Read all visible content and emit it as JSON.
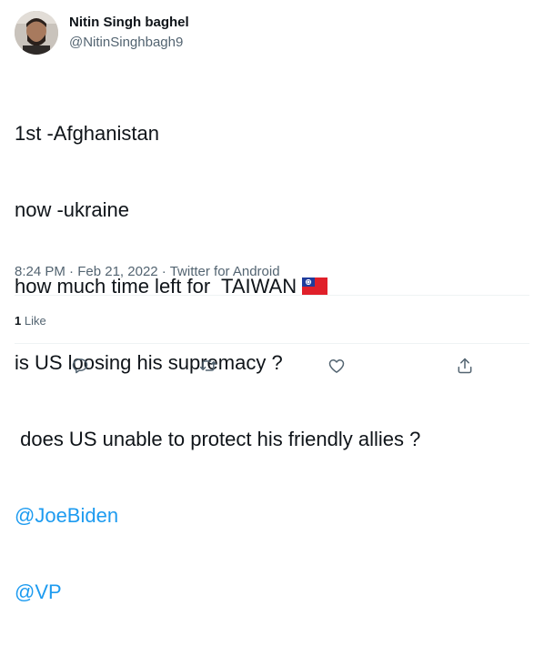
{
  "author": {
    "display_name": "Nitin Singh baghel",
    "handle": "@NitinSinghbagh9"
  },
  "tweet": {
    "lines": [
      {
        "text": "1st -Afghanistan"
      },
      {
        "text": "now -ukraine"
      },
      {
        "text": "how much time left for  TAIWAN",
        "emoji": "taiwan-flag"
      },
      {
        "text": "is US loosing his supremacy ?"
      },
      {
        "text": " does US unable to protect his friendly allies ?"
      }
    ],
    "mentions": [
      "@JoeBiden",
      "@VP"
    ]
  },
  "meta": {
    "time": "8:24 PM",
    "sep1": " · ",
    "date": "Feb 21, 2022",
    "sep2": " · ",
    "source": "Twitter for Android"
  },
  "stats": {
    "likes_count": "1",
    "likes_label": "Like"
  },
  "actions": [
    "reply-icon",
    "retweet-icon",
    "like-icon",
    "share-icon"
  ],
  "colors": {
    "link": "#1d9bf0",
    "secondary_text": "#536471",
    "primary_text": "#0f1419",
    "divider": "#eff3f4"
  }
}
